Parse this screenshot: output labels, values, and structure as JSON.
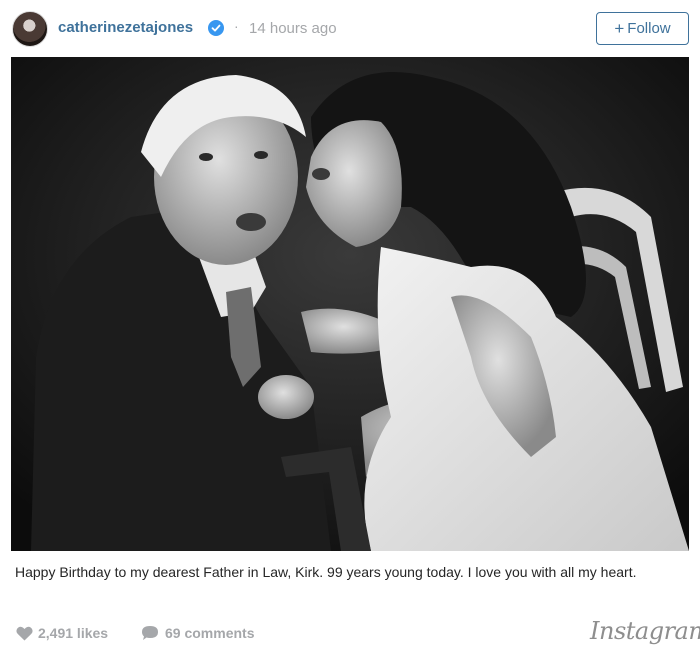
{
  "header": {
    "username": "catherinezetajones",
    "separator": "·",
    "timestamp": "14 hours ago",
    "follow_plus": "+",
    "follow_label": "Follow",
    "verified_icon": "verified-badge-icon",
    "accent_color": "#3f729b"
  },
  "post": {
    "caption": "Happy Birthday to my dearest Father in Law, Kirk. 99 years young today. I love you with all my heart."
  },
  "footer": {
    "likes": "2,491 likes",
    "comments": "69 comments",
    "brand": "Instagram"
  }
}
